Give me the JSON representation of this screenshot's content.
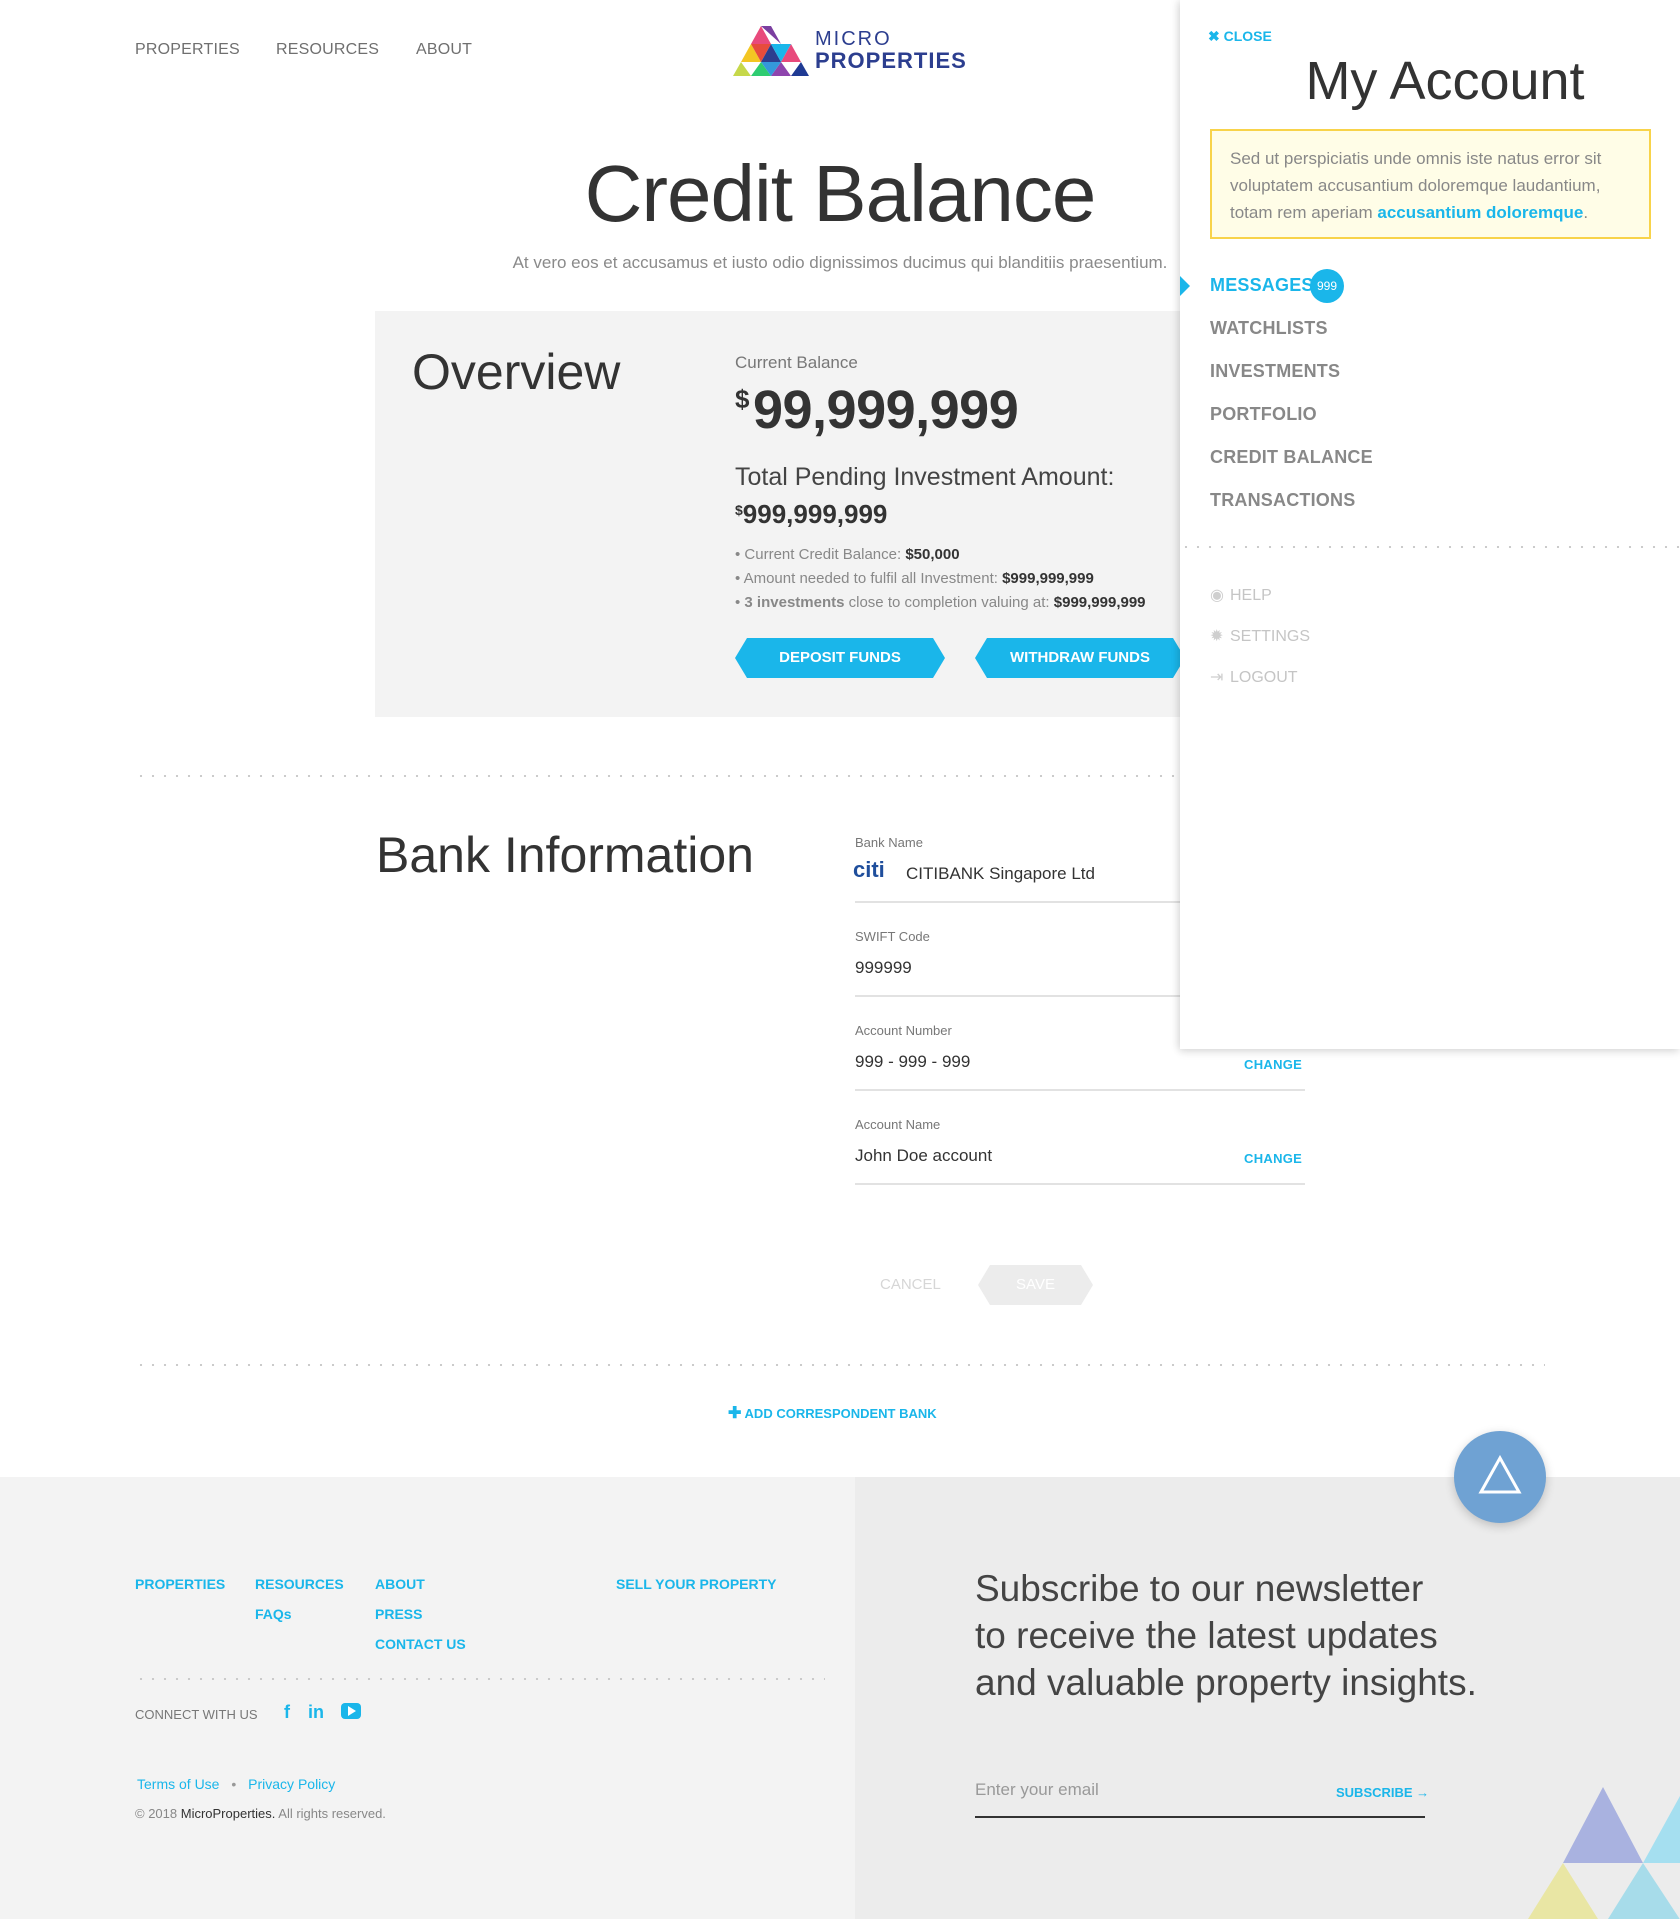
{
  "nav": {
    "properties": "PROPERTIES",
    "resources": "RESOURCES",
    "about": "ABOUT"
  },
  "logo": {
    "line1": "MICRO",
    "line2": "PROPERTIES"
  },
  "page": {
    "title": "Credit Balance",
    "subtitle": "At vero eos et accusamus et iusto odio dignissimos ducimus qui blanditiis praesentium."
  },
  "overview": {
    "title": "Overview",
    "current_balance_label": "Current Balance",
    "currency": "$",
    "current_balance_value": "99,999,999",
    "pending_label": "Total Pending Investment Amount:",
    "pending_value": "999,999,999",
    "bullet1_text": "Current Credit Balance: ",
    "bullet1_value": "$50,000",
    "bullet2_text": "Amount needed to fulfil all Investment: ",
    "bullet2_value": "$999,999,999",
    "bullet3_bold": "3 investments",
    "bullet3_text": " close to completion valuing at: ",
    "bullet3_value": "$999,999,999",
    "deposit_label": "DEPOSIT FUNDS",
    "withdraw_label": "WITHDRAW FUNDS"
  },
  "bank": {
    "title": "Bank Information",
    "bank_name_label": "Bank Name",
    "bank_logo_text": "citi",
    "bank_name_value": "CITIBANK Singapore Ltd",
    "swift_label": "SWIFT Code",
    "swift_value": "999999",
    "account_number_label": "Account Number",
    "account_number_value": "999 - 999 - 999",
    "account_name_label": "Account Name",
    "account_name_value": "John Doe account",
    "change_label": "CHANGE",
    "cancel_label": "CANCEL",
    "save_label": "SAVE",
    "add_bank_label": "ADD CORRESPONDENT BANK"
  },
  "footer": {
    "properties": "PROPERTIES",
    "resources": "RESOURCES",
    "faqs": "FAQs",
    "about": "ABOUT",
    "press": "PRESS",
    "contact": "CONTACT US",
    "sell": "SELL YOUR PROPERTY",
    "connect": "CONNECT WITH US",
    "terms": "Terms of Use",
    "privacy": "Privacy Policy",
    "copyright_prefix": "© 2018 ",
    "copyright_brand": "MicroProperties.",
    "copyright_suffix": " All rights reserved.",
    "newsletter_line1": "Subscribe to our newsletter",
    "newsletter_line2": "to receive the latest updates",
    "newsletter_line3": "and valuable property insights.",
    "email_placeholder": "Enter your email",
    "subscribe_label": "SUBSCRIBE →"
  },
  "account": {
    "close_label": "CLOSE",
    "title": "My Account",
    "notice_text": "Sed ut perspiciatis unde omnis iste natus error sit voluptatem accusantium doloremque laudantium, totam rem aperiam ",
    "notice_link": "accusantium doloremque",
    "notice_end": ".",
    "messages": "MESSAGES",
    "messages_badge": "999",
    "watchlists": "WATCHLISTS",
    "investments": "INVESTMENTS",
    "portfolio": "PORTFOLIO",
    "credit_balance": "CREDIT BALANCE",
    "transactions": "TRANSACTIONS",
    "help": "HELP",
    "settings": "SETTINGS",
    "logout": "LOGOUT"
  },
  "colors": {
    "accent": "#1ab6ea",
    "notice_border": "#f8d34a",
    "brand": "#2c3e8f"
  }
}
